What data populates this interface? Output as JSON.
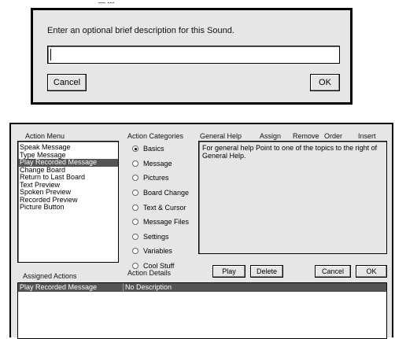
{
  "dialog": {
    "top_fragment": "— ---",
    "prompt": "Enter an optional brief description for this Sound.",
    "input_value": "",
    "cancel_label": "Cancel",
    "ok_label": "OK"
  },
  "headers": {
    "action_menu": "Action Menu",
    "action_categories": "Action Categories",
    "general_help": "General Help",
    "assign": "Assign",
    "remove": "Remove",
    "order": "Order",
    "insert": "Insert"
  },
  "action_menu": {
    "items": [
      "Speak Message",
      "Type Message",
      "Play Recorded Message",
      "Change Board",
      "Return to Last Board",
      "Text Preview",
      "Spoken Preview",
      "Recorded Preview",
      "Picture Button"
    ],
    "selected": "Play Recorded Message"
  },
  "categories": {
    "items": [
      "Basics",
      "Message",
      "Pictures",
      "Board Change",
      "Text & Cursor",
      "Message Files",
      "Settings",
      "Variables",
      "Cool Stuff"
    ],
    "selected": "Basics"
  },
  "help_text": "For general help Point to one of the topics to the right of General Help.",
  "labels": {
    "assigned_actions": "Assigned Actions",
    "action_details": "Action Details"
  },
  "buttons": {
    "play": "Play",
    "delete": "Delete",
    "cancel": "Cancel",
    "ok": "OK"
  },
  "assigned_row": {
    "action": "Play Recorded Message",
    "details": "No Description"
  }
}
